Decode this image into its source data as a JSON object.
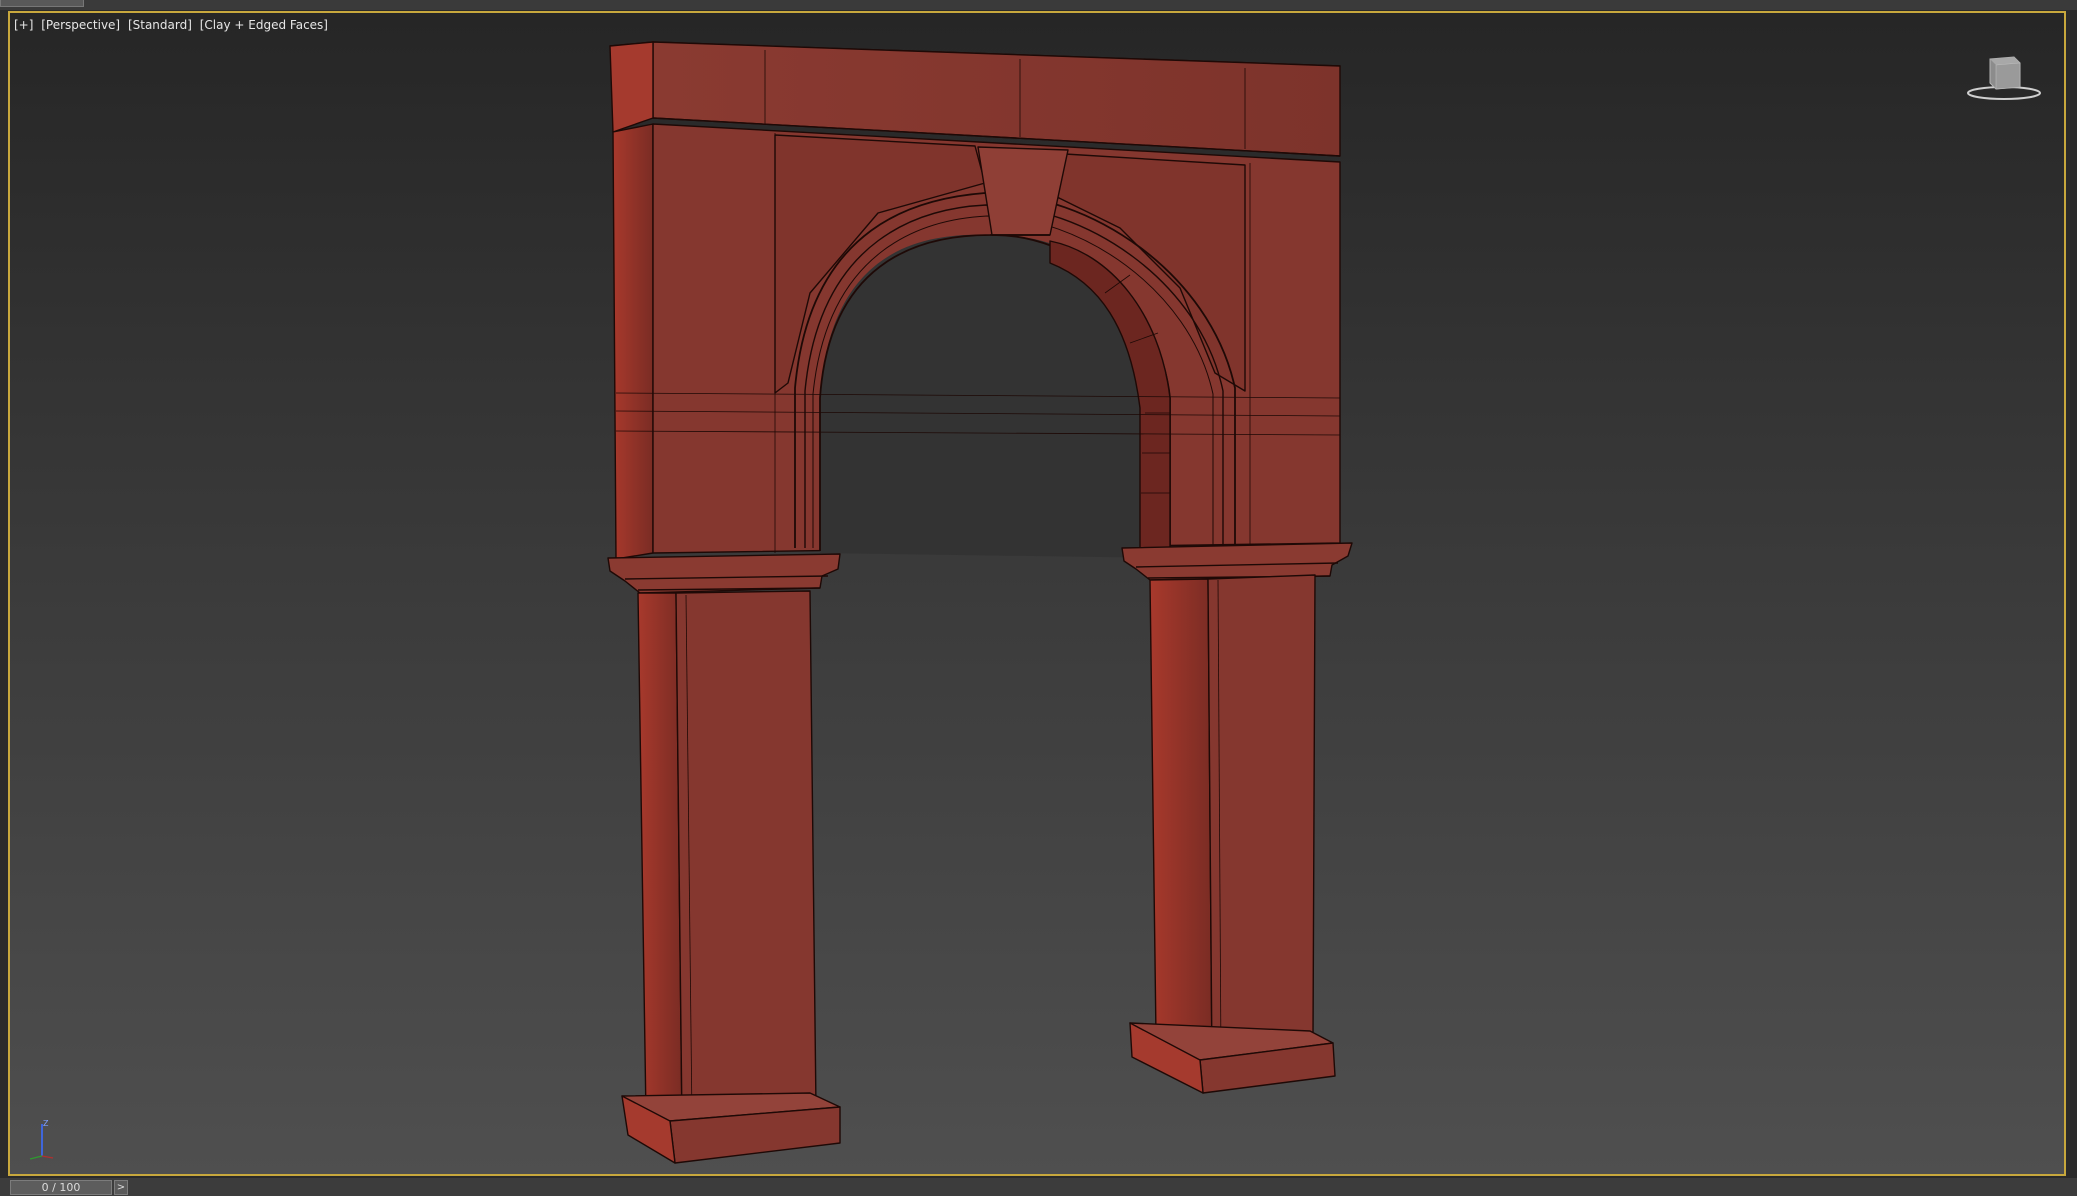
{
  "viewport": {
    "label_parts": [
      "[+]",
      "[Perspective]",
      "[Standard]",
      "[Clay + Edged Faces]"
    ]
  },
  "viewcube": {
    "icon": "viewcube-icon"
  },
  "axis_tripod": {
    "icon": "axis-tripod-icon",
    "axis_label": "Z"
  },
  "timeline": {
    "frame_display": "0 / 100",
    "next_label": ">"
  },
  "colors": {
    "viewport_border": "#c8a83d",
    "clay_face": "#85372f",
    "clay_side": "#6b2a24",
    "clay_edge": "#1e0906"
  }
}
